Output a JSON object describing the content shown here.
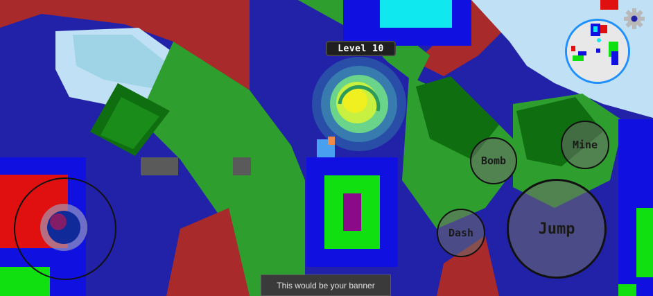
{
  "hud": {
    "level_label": "Level 10",
    "banner_text": "This would be your banner"
  },
  "buttons": {
    "bomb": "Bomb",
    "mine": "Mine",
    "dash": "Dash",
    "jump": "Jump"
  },
  "icons": {
    "settings": "gear-icon",
    "joystick": "joystick-icon",
    "portal": "swirl-portal",
    "minimap": "minimap"
  },
  "colors": {
    "water": "#2222a8",
    "grass": "#2e9e2e",
    "dirt": "#a82a2a",
    "ice": "#bfe0f5",
    "portal_core": "#e8f020",
    "minimap_ring": "#1e90ff"
  }
}
